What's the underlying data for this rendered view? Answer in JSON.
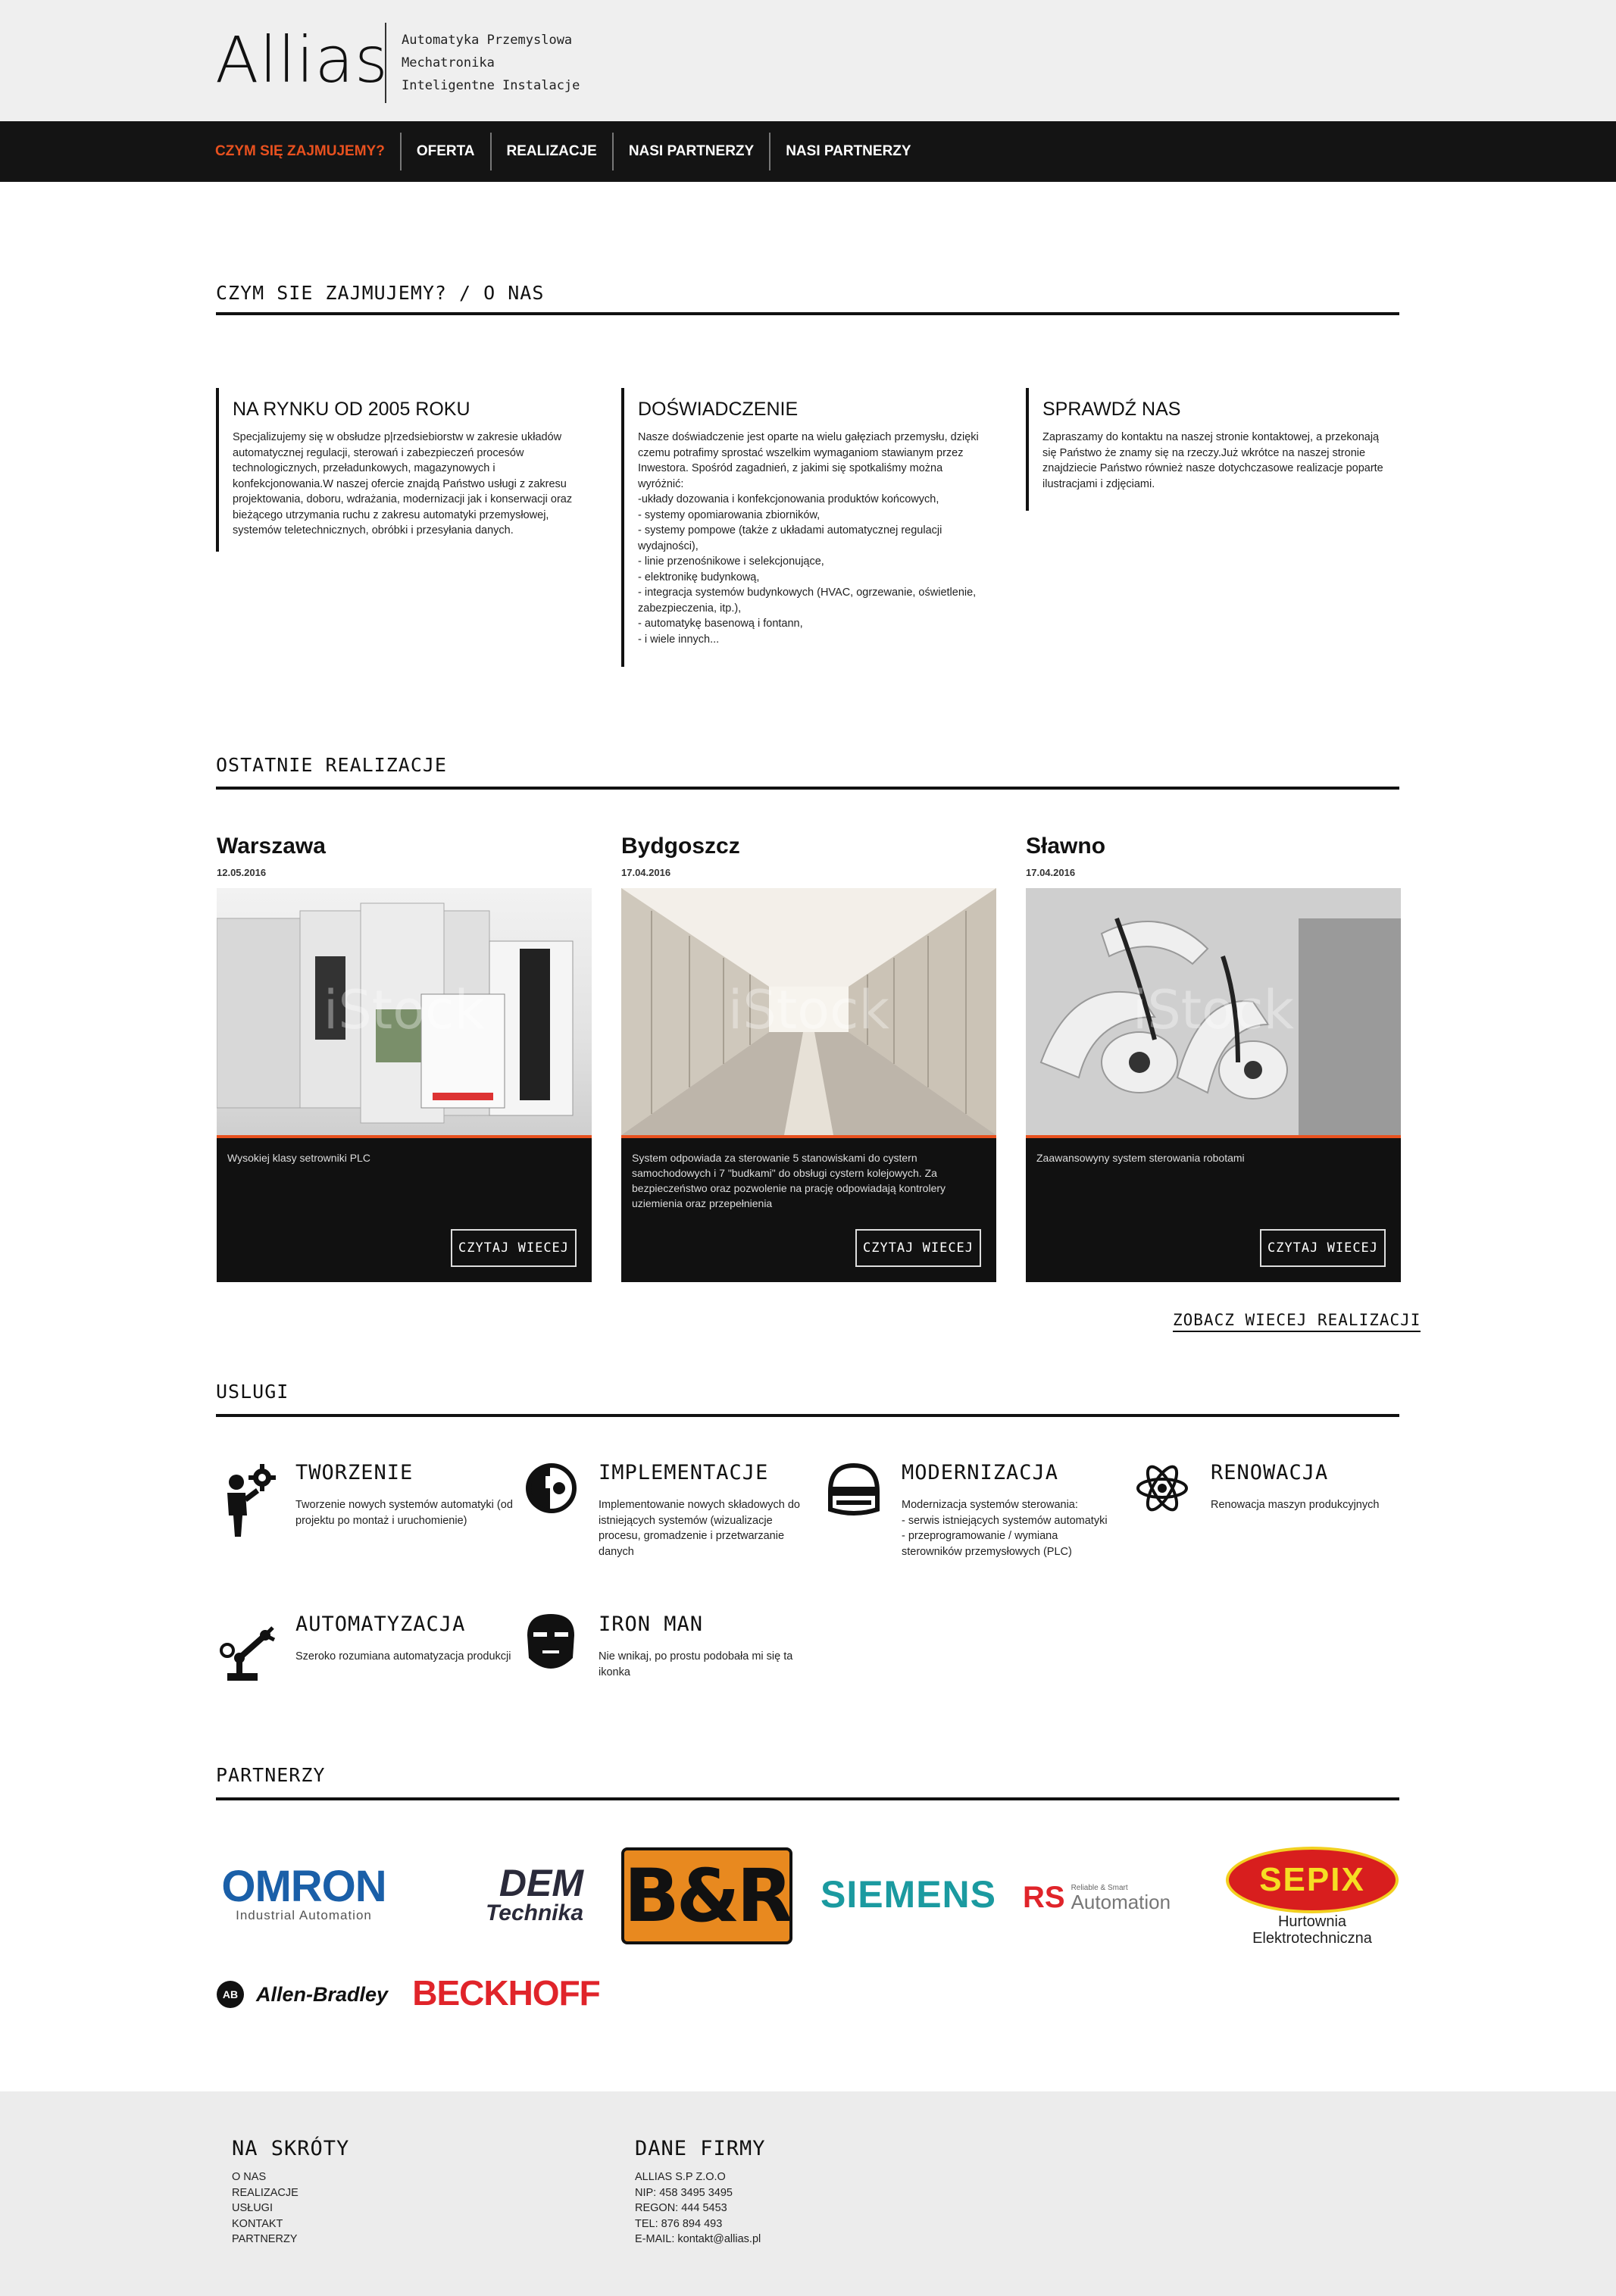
{
  "header": {
    "logo": "Allias",
    "tagline": [
      "Automatyka Przemyslowa",
      "Mechatronika",
      "Inteligentne Instalacje"
    ]
  },
  "nav": {
    "items": [
      "CZYM SIĘ ZAJMUJEMY?",
      "OFERTA",
      "REALIZACJE",
      "NASI PARTNERZY",
      "NASI PARTNERZY"
    ],
    "active_color": "#e8511f"
  },
  "about": {
    "title": "CZYM SIE ZAJMUJEMY? / O NAS",
    "columns": [
      {
        "heading": "NA RYNKU OD 2005 ROKU",
        "text": "Specjalizujemy się  w obsłudze p|rzedsiebiorstw w zakresie układów\nautomatycznej regulacji, sterowań  i zabezpieczeń procesów\ntechnologicznych, przeładunkowych, magazynowych i\nkonfekcjonowania.W naszej ofercie znajdą Państwo usługi z zakresu\nprojektowania, doboru, wdrażania, modernizacji jak i konserwacji oraz\nbieżącego utrzymania ruchu z zakresu automatyki przemysłowej,\nsystemów teletechnicznych, obróbki i przesyłania danych."
      },
      {
        "heading": "DOŚWIADCZENIE",
        "text": "Nasze doświadczenie jest oparte na wielu gałęziach przemysłu, dzięki\nczemu potrafimy sprostać wszelkim wymaganiom stawianym przez\nInwestora. Spośród zagadnień, z jakimi się spotkaliśmy można\nwyróżnić:\n-układy dozowania i konfekcjonowania produktów końcowych,\n- systemy opomiarowania zbiorników,\n- systemy pompowe (także z układami automatycznej regulacji\nwydajności),\n- linie przenośnikowe i selekcjonujące,\n- elektronikę budynkową,\n- integracja systemów budynkowych (HVAC, ogrzewanie, oświetlenie,\nzabezpieczenia, itp.),\n- automatykę basenową i fontann,\n- i wiele innych..."
      },
      {
        "heading": "SPRAWDŹ NAS",
        "text": "Zapraszamy do kontaktu na naszej stronie kontaktowej, a przekonają\nsię Państwo że znamy się na rzeczy.Już wkrótce na naszej stronie\nznajdziecie Państwo również nasze dotychczasowe realizacje poparte\nilustracjami i zdjęciami."
      }
    ]
  },
  "realizacje": {
    "title": "OSTATNIE REALIZACJE",
    "items": [
      {
        "city": "Warszawa",
        "date": "12.05.2016",
        "desc": "Wysokiej klasy setrowniki PLC",
        "button": "CZYTAJ WIECEJ",
        "watermark": "iStock"
      },
      {
        "city": "Bydgoszcz",
        "date": "17.04.2016",
        "desc": "System odpowiada za sterowanie 5 stanowiskami do cystern samochodowych i 7 \"budkami\" do obsługi cystern kolejowych. Za bezpieczeństwo oraz pozwolenie na prację odpowiadają kontrolery uziemienia oraz przepełnienia",
        "button": "CZYTAJ WIECEJ",
        "watermark": "iStock"
      },
      {
        "city": "Sławno",
        "date": "17.04.2016",
        "desc": "Zaawansowyny system sterowania robotami",
        "button": "CZYTAJ WIECEJ",
        "watermark": "iStock"
      }
    ],
    "more": "ZOBACZ WIECEJ REALIZACJI"
  },
  "uslugi": {
    "title": "USLUGI",
    "items": [
      {
        "name": "TWORZENIE",
        "text": "Tworzenie nowych systemów automatyki (od\nprojektu po montaż i uruchomienie)",
        "icon": "worker-gear-icon"
      },
      {
        "name": "IMPLEMENTACJE",
        "text": "Implementowanie nowych składowych do\nistniejących systemów (wizualizacje\nprocesu, gromadzenie i przetwarzanie\ndanych",
        "icon": "robot-head-icon"
      },
      {
        "name": "MODERNIZACJA",
        "text": "Modernizacja systemów sterowania:\n- serwis istniejących systemów automatyki\n- przeprogramowanie / wymiana\nsterowników przemysłowych (PLC)",
        "icon": "helmet-icon"
      },
      {
        "name": "RENOWACJA",
        "text": "Renowacja maszyn produkcyjnych",
        "icon": "atom-icon"
      },
      {
        "name": "AUTOMATYZACJA",
        "text": "Szeroko rozumiana automatyzacja produkcji",
        "icon": "robot-arm-icon"
      },
      {
        "name": "IRON MAN",
        "text": "Nie wnikaj, po prostu podobała mi się ta\nikonka",
        "icon": "iron-man-icon"
      }
    ]
  },
  "partnerzy": {
    "title": "PARTNERZY",
    "logos": [
      {
        "name": "OMRON",
        "sub": "Industrial Automation",
        "color": "#1a5fa8"
      },
      {
        "name": "DEM",
        "sub": "Technika",
        "color": "#2a2a3a"
      },
      {
        "name": "B&R",
        "color": "#e8891f"
      },
      {
        "name": "SIEMENS",
        "color": "#1b9aa0"
      },
      {
        "name": "RS",
        "sub": "Automation",
        "small": "Reliable & Smart",
        "color": "#e0242a"
      },
      {
        "name": "SEPIX",
        "sub": "Hurtownia",
        "sub2": "Elektrotechniczna",
        "color": "#d81e1e"
      },
      {
        "name": "Allen-Bradley",
        "badge": "AB",
        "color": "#111111"
      },
      {
        "name": "BECKHOFF",
        "color": "#e0242a"
      }
    ]
  },
  "footer": {
    "shortcuts_title": "NA SKRÓTY",
    "shortcuts": [
      "O NAS",
      "REALIZACJE",
      "USŁUGI",
      "KONTAKT",
      "PARTNERZY"
    ],
    "company_title": "DANE FIRMY",
    "company": [
      "ALLIAS S.P Z.O.O",
      "NIP: 458 3495 3495",
      "REGON: 444 5453",
      "TEL: 876 894 493",
      "E-MAIL: kontakt@allias.pl"
    ]
  }
}
